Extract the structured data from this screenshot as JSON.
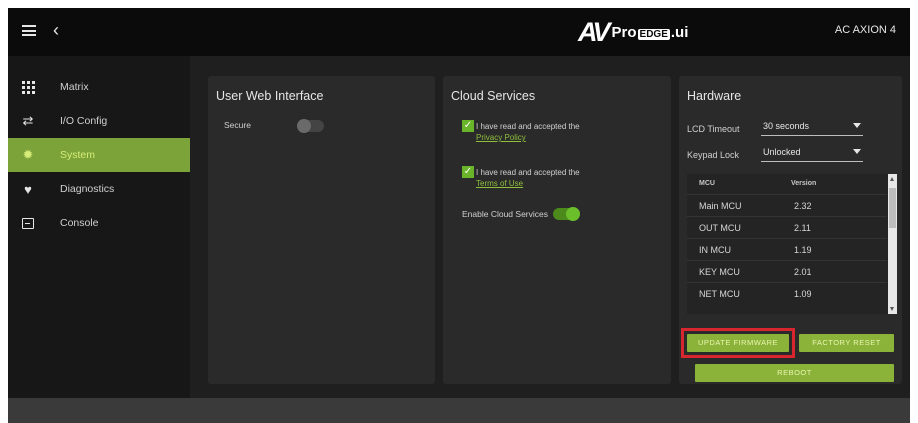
{
  "header": {
    "device_name": "AC AXION 4",
    "logo_mark": "AV",
    "logo_text_pre": "Pro",
    "logo_text_badge": "EDGE",
    "logo_text_post": ".ui"
  },
  "sidebar": {
    "items": [
      {
        "label": "Matrix",
        "icon": "grid-icon",
        "active": false
      },
      {
        "label": "I/O Config",
        "icon": "arrows-icon",
        "active": false
      },
      {
        "label": "System",
        "icon": "gear-icon",
        "active": true
      },
      {
        "label": "Diagnostics",
        "icon": "heart-icon",
        "active": false
      },
      {
        "label": "Console",
        "icon": "console-icon",
        "active": false
      }
    ]
  },
  "web_interface": {
    "title": "User Web Interface",
    "secure_label": "Secure",
    "secure_enabled": false
  },
  "cloud": {
    "title": "Cloud Services",
    "privacy_text": "I have read and accepted the",
    "privacy_link": "Privacy Policy",
    "terms_text": "I have read and accepted the",
    "terms_link": "Terms of Use",
    "enable_label": "Enable Cloud Services",
    "enable_enabled": true
  },
  "hardware": {
    "title": "Hardware",
    "lcd_label": "LCD Timeout",
    "lcd_value": "30 seconds",
    "keypad_label": "Keypad Lock",
    "keypad_value": "Unlocked",
    "table": {
      "col_mcu": "MCU",
      "col_version": "Version",
      "rows": [
        {
          "mcu": "Main MCU",
          "version": "2.32"
        },
        {
          "mcu": "OUT MCU",
          "version": "2.11"
        },
        {
          "mcu": "IN MCU",
          "version": "1.19"
        },
        {
          "mcu": "KEY MCU",
          "version": "2.01"
        },
        {
          "mcu": "NET MCU",
          "version": "1.09"
        }
      ]
    },
    "update_firmware_label": "UPDATE FIRMWARE",
    "factory_reset_label": "FACTORY RESET",
    "reboot_label": "REBOOT"
  },
  "colors": {
    "accent": "#7ba33a",
    "button": "#8bb33a",
    "highlight": "#d8262e"
  }
}
